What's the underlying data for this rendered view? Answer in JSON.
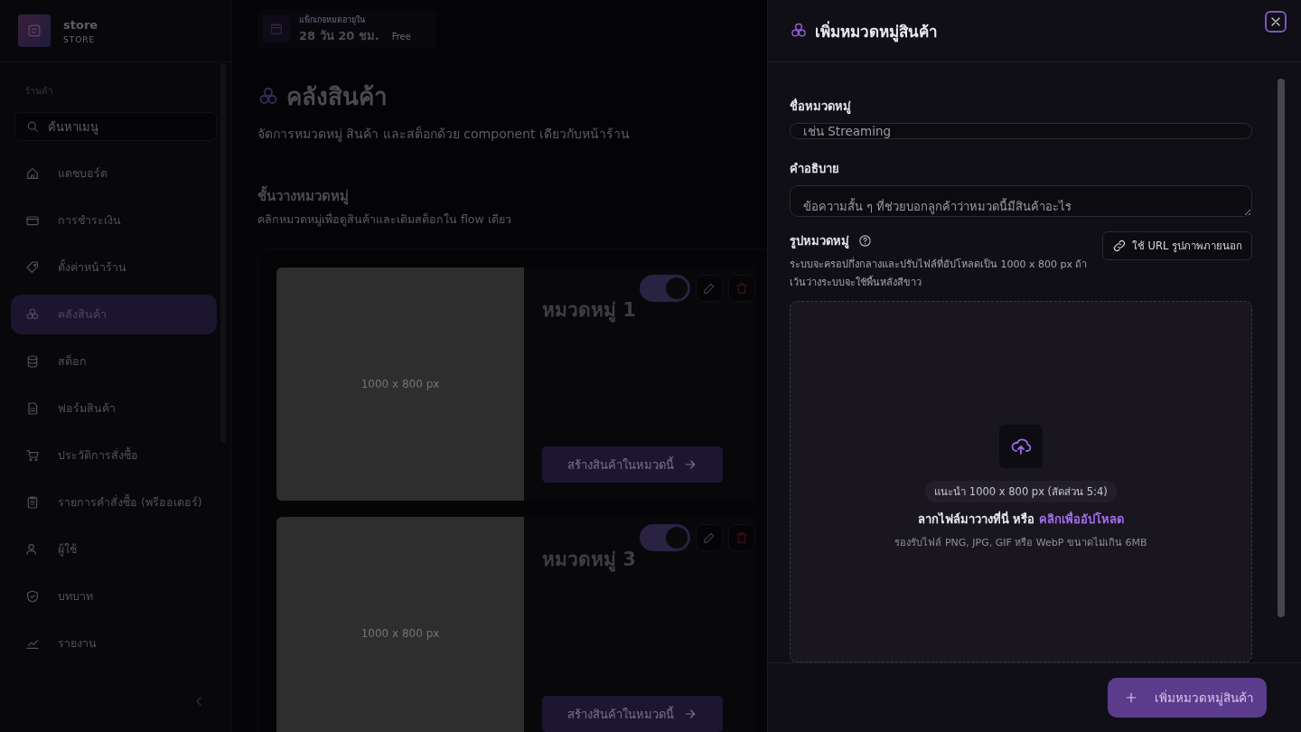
{
  "sidebar": {
    "brand": {
      "name": "store",
      "subtitle": "STORE"
    },
    "section_label": "ร้านค้า",
    "search": {
      "placeholder": "ค้นหาเมนู"
    },
    "items": [
      {
        "label": "แดชบอร์ด",
        "selected": false
      },
      {
        "label": "การชำระเงิน",
        "selected": false
      },
      {
        "label": "ตั้งค่าหน้าร้าน",
        "selected": false
      },
      {
        "label": "คลังสินค้า",
        "selected": true
      },
      {
        "label": "สต็อก",
        "selected": false
      },
      {
        "label": "ฟอร์มสินค้า",
        "selected": false
      },
      {
        "label": "ประวัติการสั่งซื้อ",
        "selected": false
      },
      {
        "label": "รายการคำสั่งซื้อ (พรีออเดอร์)",
        "selected": false
      },
      {
        "label": "ผู้ใช้",
        "selected": false
      },
      {
        "label": "บทบาท",
        "selected": false
      },
      {
        "label": "รายงาน",
        "selected": false
      }
    ]
  },
  "expiry_banner": {
    "label": "แพ็กเกจหมดอายุใน",
    "remaining": "28 วัน 20 ชม.",
    "plan": "Free"
  },
  "page": {
    "title": "คลังสินค้า",
    "subtitle": "จัดการหมวดหมู่ สินค้า และสต็อกด้วย component เดียวกับหน้าร้าน"
  },
  "shelf": {
    "title": "ชั้นวางหมวดหมู่",
    "subtitle": "คลิกหมวดหมู่เพื่อดูสินค้าและเติมสต็อกใน flow เดียว",
    "categories": [
      {
        "image_label": "1000 x 800 px",
        "name": "หมวดหมู่ 1",
        "on": true,
        "action": "สร้างสินค้าในหมวดนี้"
      },
      {
        "image_label": "1000 x 800 px",
        "name": "หมวดหมู่ 3",
        "on": true,
        "action": "สร้างสินค้าในหมวดนี้"
      }
    ]
  },
  "drawer": {
    "title": "เพิ่มหมวดหมู่สินค้า",
    "fields": [
      {
        "kind": "input",
        "label": "ชื่อหมวดหมู่",
        "placeholder": "เช่น Streaming"
      },
      {
        "kind": "textarea",
        "label": "คำอธิบาย",
        "placeholder": "ข้อความสั้น ๆ ที่ช่วยบอกลูกค้าว่าหมวดนี้มีสินค้าอะไร"
      }
    ],
    "image": {
      "label": "รูปหมวดหมู่",
      "hint": "ระบบจะครอปกึ่งกลางและปรับไฟล์ที่อัปโหลดเป็น 1000 x 800 px ถ้าเว้นว่างระบบจะใช้พื้นหลังสีขาว",
      "url_button": "ใช้ URL รูปภาพภายนอก",
      "recommendation": "แนะนำ 1000 x 800 px (สัดส่วน 5:4)",
      "drop_text": "ลากไฟล์มาวางที่นี่ หรือ",
      "drop_link": "คลิกเพื่ออัปโหลด",
      "formats": "รองรับไฟล์ PNG, JPG, GIF หรือ WebP ขนาดไม่เกิน 6MB"
    },
    "submit": "เพิ่มหมวดหมู่สินค้า"
  }
}
